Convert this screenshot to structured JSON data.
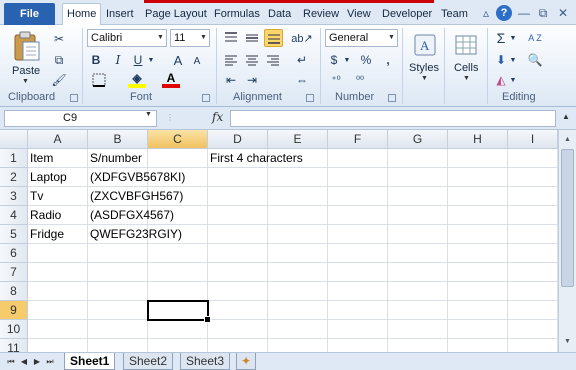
{
  "ribbon_tabs": {
    "file": "File",
    "items": [
      "Home",
      "Insert",
      "Page Layout",
      "Formulas",
      "Data",
      "Review",
      "View",
      "Developer",
      "Team"
    ]
  },
  "window_controls": {
    "minimize": "▵",
    "help": "?",
    "restore": "⧉",
    "close": "✕"
  },
  "clipboard": {
    "paste_label": "Paste",
    "cut_icon": "✂",
    "copy_icon": "⧉",
    "format_painter_icon": "🖌",
    "group_label": "Clipboard"
  },
  "font": {
    "name": "Calibri",
    "size": "11",
    "grow_label": "A",
    "shrink_label": "A",
    "bold_label": "B",
    "italic_label": "I",
    "underline_label": "U",
    "fill_label": "A",
    "color_label": "A",
    "group_label": "Font"
  },
  "alignment": {
    "group_label": "Alignment"
  },
  "number": {
    "format": "General",
    "currency": "$",
    "percent": "%",
    "comma": ",",
    "inc_decimal": "⁺⁰",
    "dec_decimal": "⁰⁰",
    "group_label": "Number"
  },
  "styles": {
    "label": "Styles"
  },
  "cells": {
    "label": "Cells"
  },
  "editing": {
    "sum_icon": "Σ",
    "sort_label": "A Z",
    "group_label": "Editing"
  },
  "formula_bar": {
    "name_box": "C9",
    "fx": "fx",
    "formula": ""
  },
  "columns": [
    "A",
    "B",
    "C",
    "D",
    "E",
    "F",
    "G",
    "H",
    "I"
  ],
  "rows": [
    "1",
    "2",
    "3",
    "4",
    "5",
    "6",
    "7",
    "8",
    "9",
    "10",
    "11"
  ],
  "cells_data": {
    "A1": "Item",
    "B1": "S/number",
    "D1": "First 4 characters",
    "A2": "Laptop",
    "B2": "(XDFGVB5678KI)",
    "A3": "Tv",
    "B3": "(ZXCVBFGH567)",
    "A4": "Radio",
    "B4": "(ASDFGX4567)",
    "A5": "Fridge",
    "B5": "QWEFG23RGIY)"
  },
  "sheet_tabs": [
    "Sheet1",
    "Sheet2",
    "Sheet3"
  ],
  "active_sheet": "Sheet1",
  "colors": {
    "file_tab": "#2a62b2",
    "selected_header": "#f5cb6b",
    "ribbon_bg": "#dfe9f5",
    "top_red_bar": "#cc0000"
  }
}
